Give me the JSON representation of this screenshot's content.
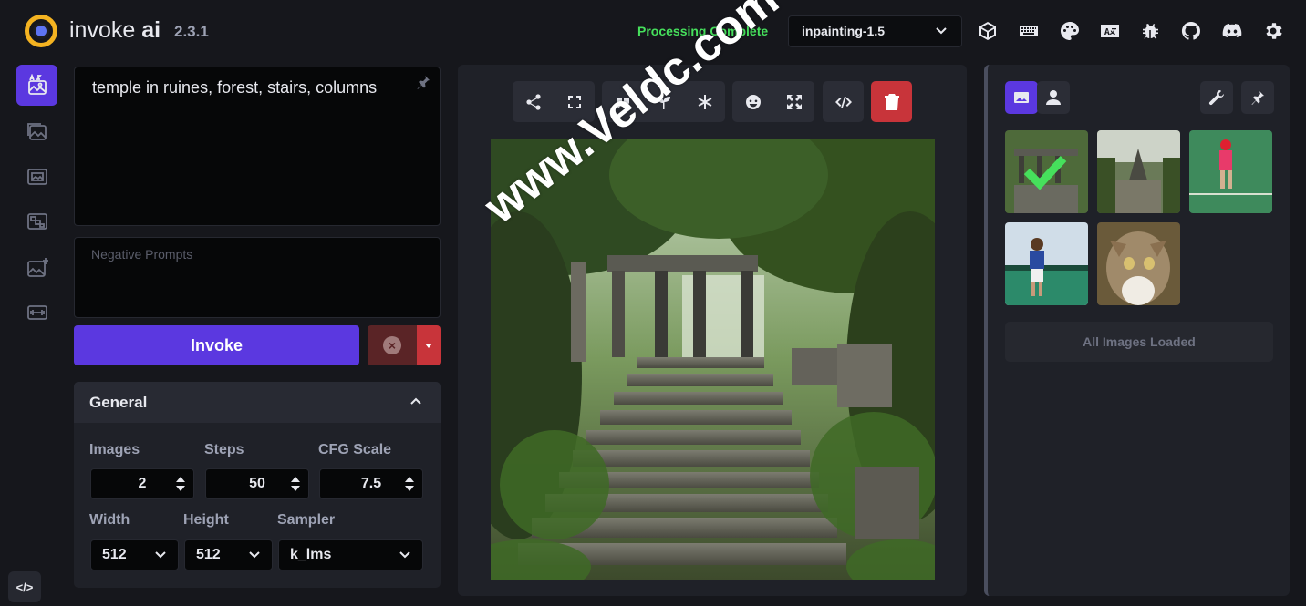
{
  "app": {
    "brand_name": "invoke",
    "brand_suffix": "ai",
    "version": "2.3.1",
    "status": "Processing Complete",
    "model": "inpainting-1.5"
  },
  "header_icons": [
    "cube-icon",
    "keyboard-icon",
    "palette-icon",
    "translate-icon",
    "bug-icon",
    "github-icon",
    "discord-icon",
    "gear-icon"
  ],
  "nav": [
    "text-to-image-icon",
    "image-to-image-icon",
    "unified-canvas-icon",
    "nodes-icon",
    "postprocessing-icon",
    "training-icon"
  ],
  "prompt": {
    "text": "temple in ruines, forest, stairs, columns",
    "negative_placeholder": "Negative Prompts"
  },
  "invoke": {
    "label": "Invoke"
  },
  "general": {
    "title": "General",
    "images_label": "Images",
    "images_value": "2",
    "steps_label": "Steps",
    "steps_value": "50",
    "cfg_label": "CFG Scale",
    "cfg_value": "7.5",
    "width_label": "Width",
    "width_value": "512",
    "height_label": "Height",
    "height_value": "512",
    "sampler_label": "Sampler",
    "sampler_value": "k_lms"
  },
  "gallery": {
    "status": "All Images Loaded"
  },
  "console": {
    "label": "</>"
  },
  "watermark": "www.Veldc.com",
  "colors": {
    "accent": "#5b38e0",
    "status": "#46e05c",
    "danger": "#c8343a",
    "logo": "#f4b321"
  }
}
